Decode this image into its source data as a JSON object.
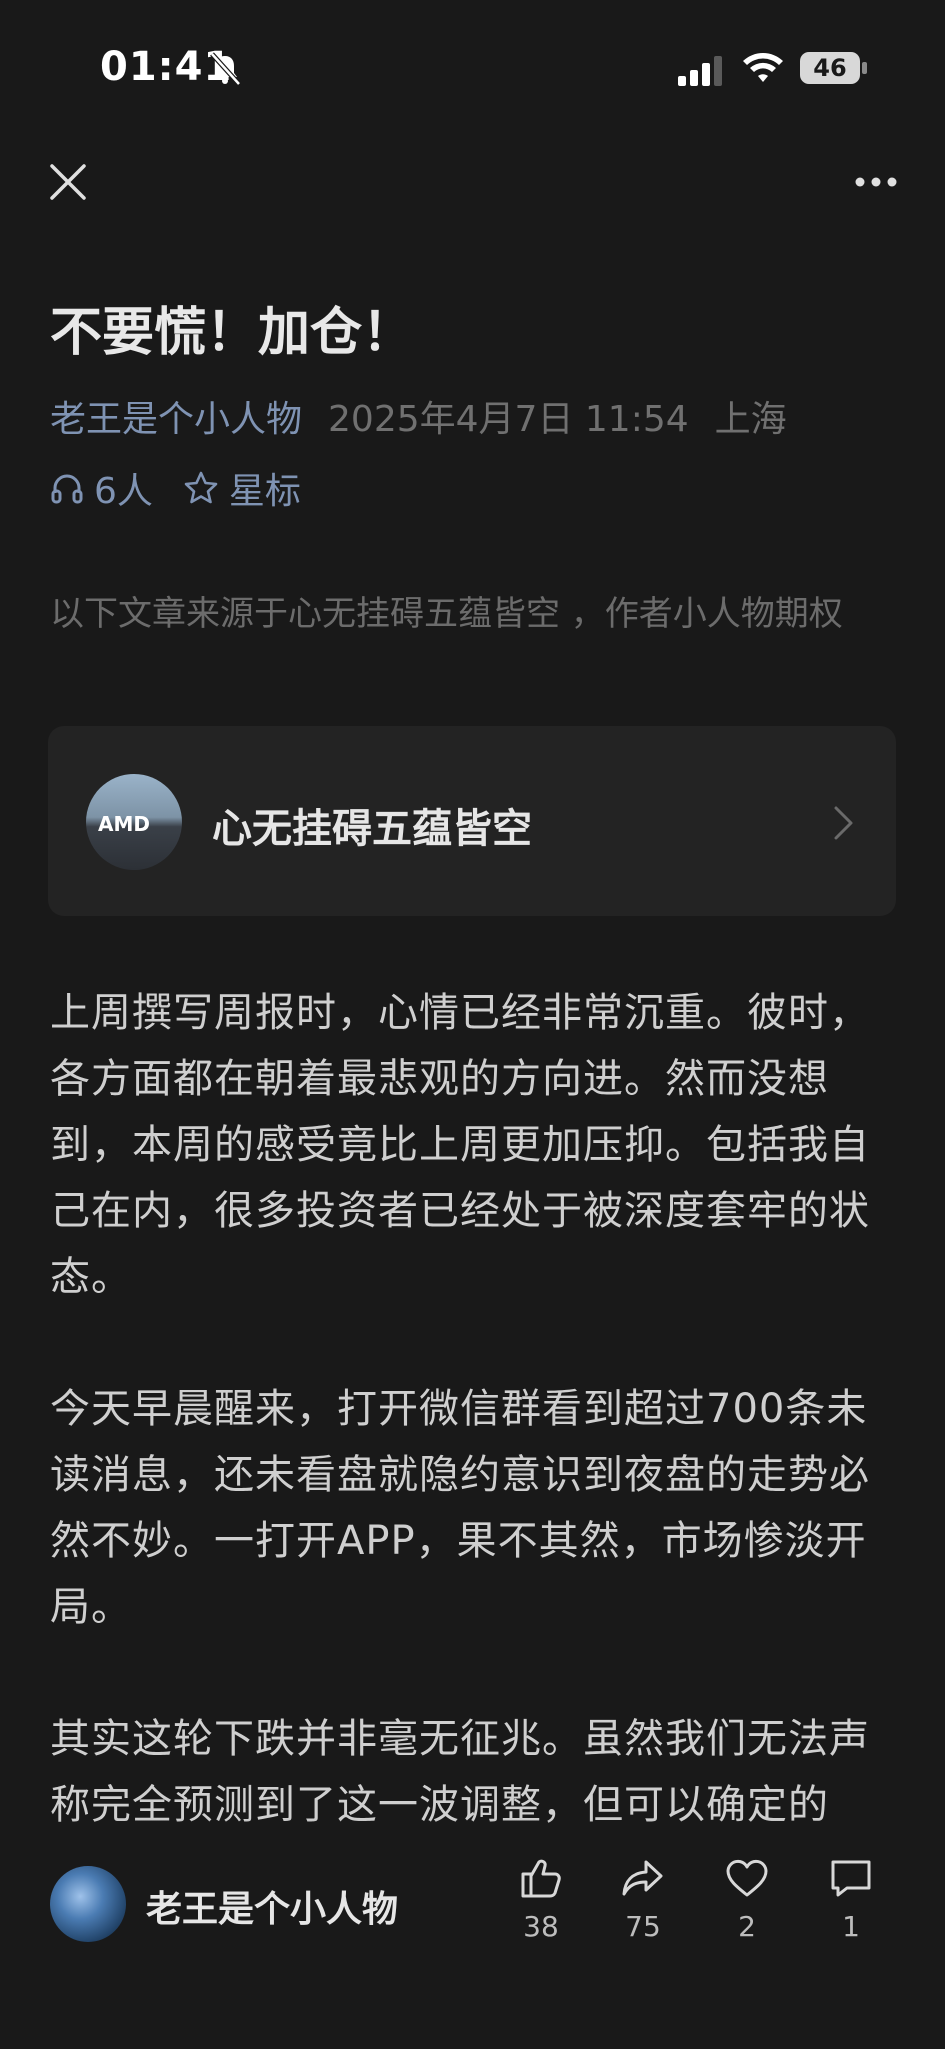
{
  "status_bar": {
    "time": "01:41",
    "battery": "46"
  },
  "article": {
    "title": "不要慌！加仓！",
    "author": "老王是个小人物",
    "date": "2025年4月7日 11:54",
    "location": "上海",
    "listeners": "6人",
    "star_label": "星标",
    "source_note": "以下文章来源于心无挂碍五蕴皆空 ，作者小人物期权",
    "source_card": {
      "name": "心无挂碍五蕴皆空",
      "avatar_text": "AMD"
    },
    "paragraphs": [
      "上周撰写周报时，心情已经非常沉重。彼时，各方面都在朝着最悲观的方向进。然而没想到，本周的感受竟比上周更加压抑。包括我自己在内，很多投资者已经处于被深度套牢的状态。",
      "今天早晨醒来，打开微信群看到超过700条未读消息，还未看盘就隐约意识到夜盘的走势必然不妙。一打开APP，果不其然，市场惨淡开局。",
      "其实这轮下跌并非毫无征兆。虽然我们无法声称完全预测到了这一波调整，但可以确定的是，上周的反弹幅度并未达到我们所设定的关"
    ]
  },
  "bottom_bar": {
    "name": "老王是个小人物",
    "like_count": "38",
    "share_count": "75",
    "favorite_count": "2",
    "comment_count": "1"
  }
}
